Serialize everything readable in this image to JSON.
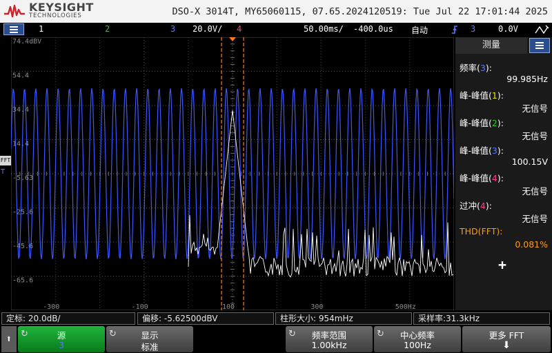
{
  "title_bar": {
    "brand": "KEYSIGHT",
    "brand_sub": "TECHNOLOGIES",
    "instrument_info": "DSO-X 3014T, MY65060115, 07.65.2024120519: Tue Jul 22 17:01:44 2025"
  },
  "status_bar": {
    "ch1": "1",
    "ch2": "2",
    "ch3": "3",
    "ch3_scale": "20.0V/",
    "ch4": "4",
    "timebase": "50.00ms/",
    "delay": "-400.0us",
    "trigger_mode": "自动",
    "trigger_source": "3",
    "trigger_level": "0.0V",
    "trigger_icon": "trigger-edge-icon"
  },
  "left_strip": {
    "fft_label": "FFT",
    "trigger_marker": "T"
  },
  "graticule": {
    "y_labels": [
      "74.4dBV",
      "54.4",
      "34.4",
      "14.4",
      "-5.63",
      "-25.6",
      "-45.6",
      "-65.6"
    ],
    "x_labels": [
      "-300",
      "-100",
      "100",
      "300",
      "500Hz"
    ]
  },
  "measurements": {
    "tab_label": "测量",
    "items": [
      {
        "name": "频率",
        "channel": "3",
        "value": "99.985Hz",
        "color": "#ffffff",
        "ch_color": "#5a78ff"
      },
      {
        "name": "峰-峰值",
        "channel": "1",
        "value": "无信号",
        "color": "#ffffff",
        "ch_color": "#e8e800"
      },
      {
        "name": "峰-峰值",
        "channel": "2",
        "value": "无信号",
        "color": "#ffffff",
        "ch_color": "#22cc22"
      },
      {
        "name": "峰-峰值",
        "channel": "3",
        "value": "100.15V",
        "color": "#ffffff",
        "ch_color": "#5a78ff"
      },
      {
        "name": "峰-峰值",
        "channel": "4",
        "value": "无信号",
        "color": "#ffffff",
        "ch_color": "#ff3c8c"
      },
      {
        "name": "过冲",
        "channel": "4",
        "value": "无信号",
        "color": "#ffffff",
        "ch_color": "#ff3c8c"
      },
      {
        "name": "THD",
        "channel": "FFT",
        "value": "0.081%",
        "color": "#ff9a1e",
        "ch_color": "#ff9a1e"
      }
    ],
    "add_label": "+"
  },
  "info_bar": {
    "scale": "定标:  20.0dB/",
    "offset": "偏移:  -5.62500dBV",
    "bin": "柱形大小: 954mHz",
    "sample_rate": "采样率:31.3kHz"
  },
  "softkeys": {
    "back_icon": "up-arrow-icon",
    "source_label": "源",
    "source_value": "3",
    "display_label": "显示",
    "display_value": "标准",
    "span_label": "频率范围",
    "span_value": "1.00kHz",
    "center_label": "中心频率",
    "center_value": "100Hz",
    "more_label": "更多 FFT",
    "more_icon": "down-arrow-icon"
  },
  "colors": {
    "ch1": "#e8e800",
    "ch2": "#22cc22",
    "ch3": "#3b57ff",
    "ch4": "#ff3c8c",
    "fft": "#ffffff",
    "cursor": "#ff7a1a"
  }
}
